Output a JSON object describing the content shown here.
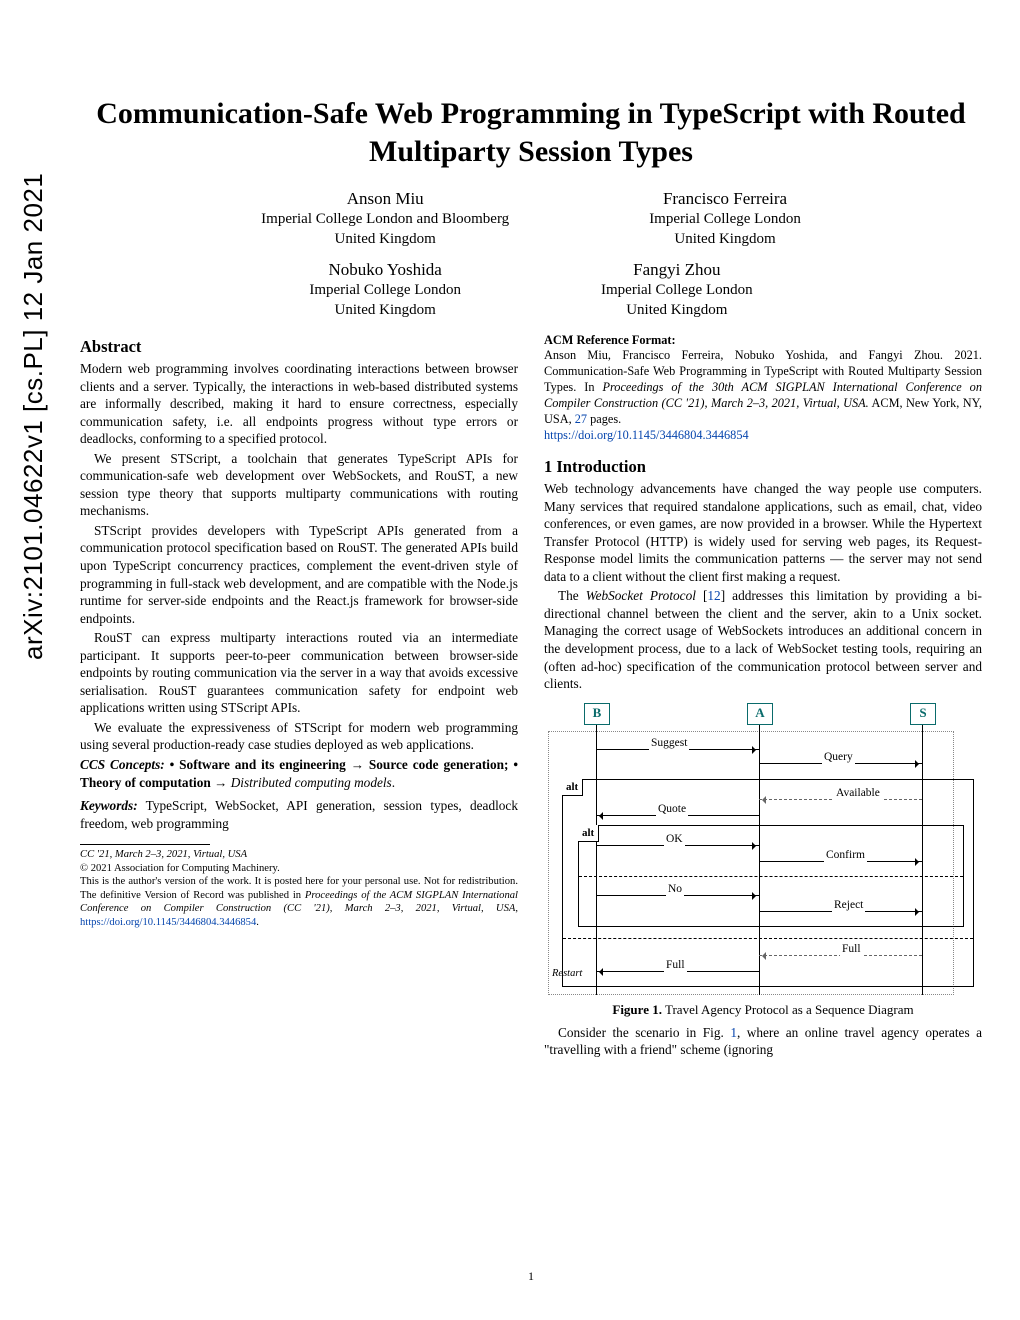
{
  "arxiv_side": "arXiv:2101.04622v1  [cs.PL]  12 Jan 2021",
  "title": "Communication-Safe Web Programming in TypeScript with Routed Multiparty Session Types",
  "authors": [
    {
      "name": "Anson Miu",
      "affil": "Imperial College London and Bloomberg",
      "country": "United Kingdom"
    },
    {
      "name": "Francisco Ferreira",
      "affil": "Imperial College London",
      "country": "United Kingdom"
    },
    {
      "name": "Nobuko Yoshida",
      "affil": "Imperial College London",
      "country": "United Kingdom"
    },
    {
      "name": "Fangyi Zhou",
      "affil": "Imperial College London",
      "country": "United Kingdom"
    }
  ],
  "abstract_hd": "Abstract",
  "abstract_p1": "Modern web programming involves coordinating interactions between browser clients and a server. Typically, the interactions in web-based distributed systems are informally described, making it hard to ensure correctness, especially communication safety, i.e. all endpoints progress without type errors or deadlocks, conforming to a specified protocol.",
  "abstract_p2": "We present STScript, a toolchain that generates TypeScript APIs for communication-safe web development over WebSockets, and RouST, a new session type theory that supports multiparty communications with routing mechanisms.",
  "abstract_p3": "STScript provides developers with TypeScript APIs generated from a communication protocol specification based on RouST. The generated APIs build upon TypeScript concurrency practices, complement the event-driven style of programming in full-stack web development, and are compatible with the Node.js runtime for server-side endpoints and the React.js framework for browser-side endpoints.",
  "abstract_p4": "RouST can express multiparty interactions routed via an intermediate participant. It supports peer-to-peer communication between browser-side endpoints by routing communication via the server in a way that avoids excessive serialisation. RouST guarantees communication safety for endpoint web applications written using STScript APIs.",
  "abstract_p5": "We evaluate the expressiveness of STScript for modern web programming using several production-ready case studies deployed as web applications.",
  "ccs_label": "CCS Concepts:",
  "ccs_text_1": " • Software and its engineering → Source code generation; • Theory of computation → ",
  "ccs_text_2": "Distributed computing models",
  "keywords_label": "Keywords:",
  "keywords_text": " TypeScript, WebSocket, API generation, session types, deadlock freedom, web programming",
  "footnote_venue_short": "CC '21, March 2–3, 2021, Virtual, USA",
  "footnote_copyright": "© 2021 Association for Computing Machinery.",
  "footnote_body_1": "This is the author's version of the work. It is posted here for your personal use. Not for redistribution. The definitive Version of Record was published in ",
  "footnote_body_venue": "Proceedings of the ACM SIGPLAN International Conference on Compiler Construction (CC '21), March 2–3, 2021, Virtual, USA",
  "footnote_body_2": ", ",
  "footnote_doi": "https://doi.org/10.1145/3446804.3446854",
  "footnote_period": ".",
  "ref_format_hd": "ACM Reference Format:",
  "ref_format_body_1": "Anson Miu, Francisco Ferreira, Nobuko Yoshida, and Fangyi Zhou. 2021. Communication-Safe Web Programming in TypeScript with Routed Multiparty Session Types. In ",
  "ref_format_body_venue": "Proceedings of the 30th ACM SIGPLAN International Conference on Compiler Construction (CC '21), March 2–3, 2021, Virtual, USA.",
  "ref_format_body_2": " ACM, New York, NY, USA, ",
  "ref_format_pages": "27",
  "ref_format_body_3": " pages. ",
  "ref_format_doi": "https://doi.org/10.1145/3446804.3446854",
  "intro_hd": "1   Introduction",
  "intro_p1": "Web technology advancements have changed the way people use computers. Many services that required standalone applications, such as email, chat, video conferences, or even games, are now provided in a browser. While the Hypertext Transfer Protocol (HTTP) is widely used for serving web pages, its Request-Response model limits the communication patterns — the server may not send data to a client without the client first making a request.",
  "intro_p2_a": "The ",
  "intro_p2_ws": "WebSocket Protocol",
  "intro_p2_b": " [",
  "intro_p2_cite": "12",
  "intro_p2_c": "] addresses this limitation by providing a bi-directional channel between the client and the server, akin to a Unix socket. Managing the correct usage of WebSockets introduces an additional concern in the development process, due to a lack of WebSocket testing tools, requiring an (often ad-hoc) specification of the communication protocol between server and clients.",
  "fig1_caption_b": "Figure 1.",
  "fig1_caption": " Travel Agency Protocol as a Sequence Diagram",
  "intro_p3_a": "Consider the scenario in Fig. ",
  "intro_p3_ref": "1",
  "intro_p3_b": ", where an online travel agency operates a \"travelling with a friend\" scheme (ignoring",
  "diagram": {
    "B": "B",
    "A": "A",
    "S": "S",
    "suggest": "Suggest",
    "query": "Query",
    "alt": "alt",
    "available": "Available",
    "quote": "Quote",
    "ok": "OK",
    "confirm": "Confirm",
    "no": "No",
    "reject": "Reject",
    "full": "Full",
    "full2": "Full",
    "restart": "Restart"
  },
  "pagenum": "1"
}
